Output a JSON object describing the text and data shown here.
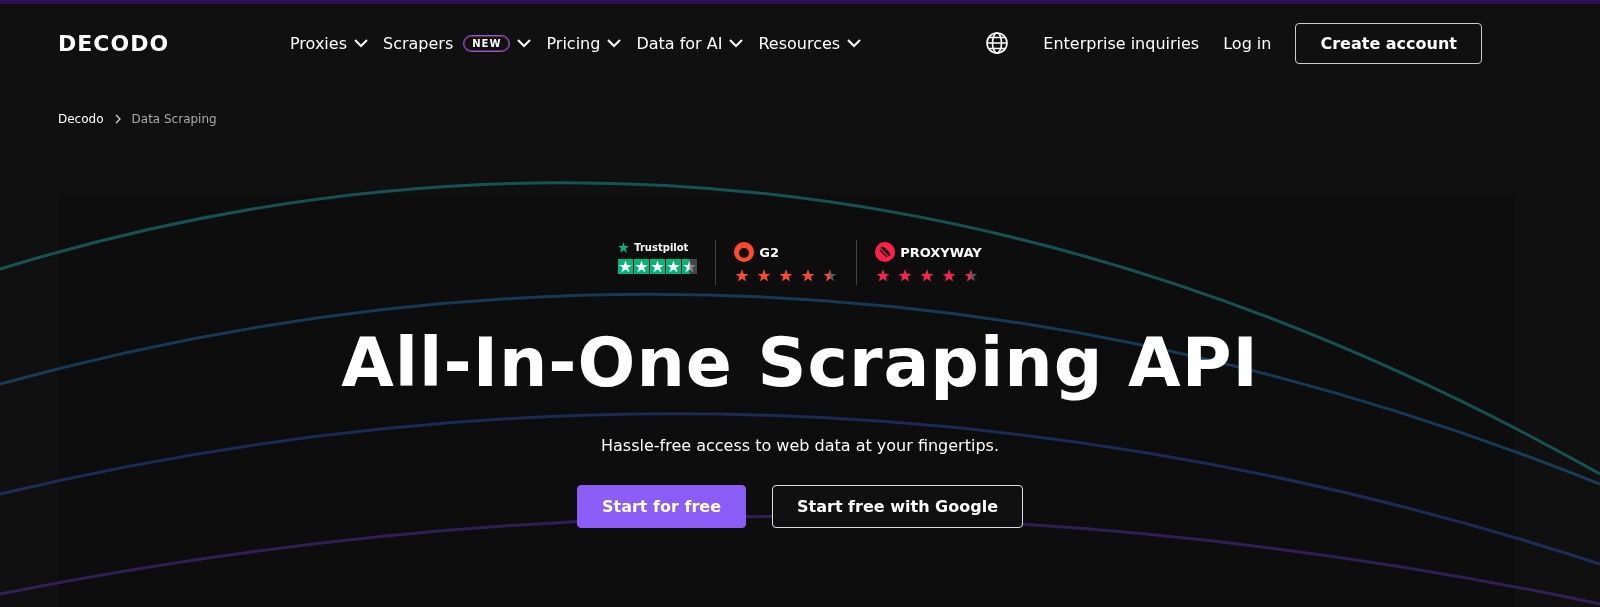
{
  "logo": "DECODO",
  "nav": [
    {
      "label": "Proxies"
    },
    {
      "label": "Scrapers",
      "badge": "NEW"
    },
    {
      "label": "Pricing"
    },
    {
      "label": "Data for AI"
    },
    {
      "label": "Resources"
    }
  ],
  "header_links": [
    "Enterprise inquiries",
    "Log in"
  ],
  "header_button": "Create account",
  "breadcrumb": [
    {
      "label": "Decodo",
      "selected": false
    },
    {
      "label": "Data Scraping",
      "selected": true
    }
  ],
  "ratings": [
    {
      "kind": "trustpilot",
      "name": "Trustpilot",
      "stars": 4.5
    },
    {
      "kind": "g2",
      "name": "G2",
      "stars": 4.5
    },
    {
      "kind": "proxyway",
      "name": "PROXYWAY",
      "stars": 4.5
    }
  ],
  "hero": {
    "title": "All-In-One Scraping API",
    "subtitle": "Hassle-free access to web data at your fingertips.",
    "buttons": [
      {
        "label": "Start for free",
        "kind": "primary"
      },
      {
        "label": "Start free with Google",
        "kind": "outline"
      }
    ]
  }
}
